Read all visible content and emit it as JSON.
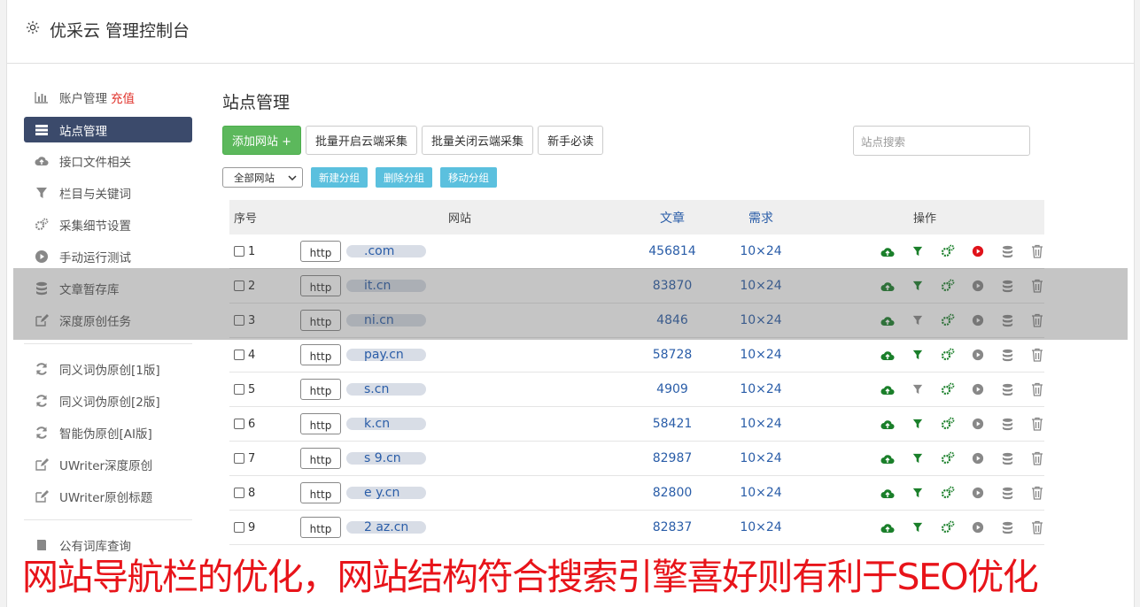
{
  "header": {
    "title": "优采云 管理控制台"
  },
  "sidebar": {
    "items": [
      {
        "label": "账户管理",
        "extra": "充值",
        "icon": "bar-chart-icon"
      },
      {
        "label": "站点管理",
        "icon": "server-icon",
        "active": true
      },
      {
        "label": "接口文件相关",
        "icon": "cloud-upload-icon"
      },
      {
        "label": "栏目与关键词",
        "icon": "filter-icon"
      },
      {
        "label": "采集细节设置",
        "icon": "gears-icon"
      },
      {
        "label": "手动运行测试",
        "icon": "play-circle-icon"
      },
      {
        "label": "文章暂存库",
        "icon": "database-icon"
      },
      {
        "label": "深度原创任务",
        "icon": "edit-icon"
      }
    ],
    "items2": [
      {
        "label": "同义词伪原创[1版]",
        "icon": "refresh-icon"
      },
      {
        "label": "同义词伪原创[2版]",
        "icon": "refresh-icon"
      },
      {
        "label": "智能伪原创[AI版]",
        "icon": "refresh-icon"
      },
      {
        "label": "UWriter深度原创",
        "icon": "edit-icon"
      },
      {
        "label": "UWriter原创标题",
        "icon": "edit-icon"
      }
    ],
    "items3": [
      {
        "label": "公有词库查询",
        "icon": "book-icon"
      }
    ]
  },
  "main": {
    "title": "站点管理",
    "toolbar": {
      "add": "添加网站 +",
      "batch_open": "批量开启云端采集",
      "batch_close": "批量关闭云端采集",
      "newbie": "新手必读"
    },
    "search_placeholder": "站点搜索",
    "group_select": "全部网站",
    "group_buttons": {
      "new": "新建分组",
      "delete": "删除分组",
      "move": "移动分组"
    },
    "table": {
      "headers": {
        "num": "序号",
        "site": "网站",
        "articles": "文章",
        "demand": "需求",
        "ops": "操作"
      },
      "http_label": "http",
      "rows": [
        {
          "num": "1",
          "domain": ".com",
          "articles": "456814",
          "demand": "10×24"
        },
        {
          "num": "2",
          "domain": "it.cn",
          "articles": "83870",
          "demand": "10×24"
        },
        {
          "num": "3",
          "domain": "ni.cn",
          "articles": "4846",
          "demand": "10×24"
        },
        {
          "num": "4",
          "domain": "pay.cn",
          "articles": "58728",
          "demand": "10×24"
        },
        {
          "num": "5",
          "domain": "s.cn",
          "articles": "4909",
          "demand": "10×24"
        },
        {
          "num": "6",
          "domain": "k.cn",
          "articles": "58421",
          "demand": "10×24"
        },
        {
          "num": "7",
          "domain": "s  9.cn",
          "articles": "82987",
          "demand": "10×24"
        },
        {
          "num": "8",
          "domain": "e   y.cn",
          "articles": "82800",
          "demand": "10×24"
        },
        {
          "num": "9",
          "domain": "2   az.cn",
          "articles": "82837",
          "demand": "10×24"
        }
      ]
    }
  },
  "caption": "网站导航栏的优化，网站结构符合搜索引擎喜好则有利于SEO优化",
  "colors": {
    "op_green": "#1a7f2a",
    "op_red": "#e0121a",
    "op_gray": "#888888",
    "link": "#2a5da8"
  }
}
